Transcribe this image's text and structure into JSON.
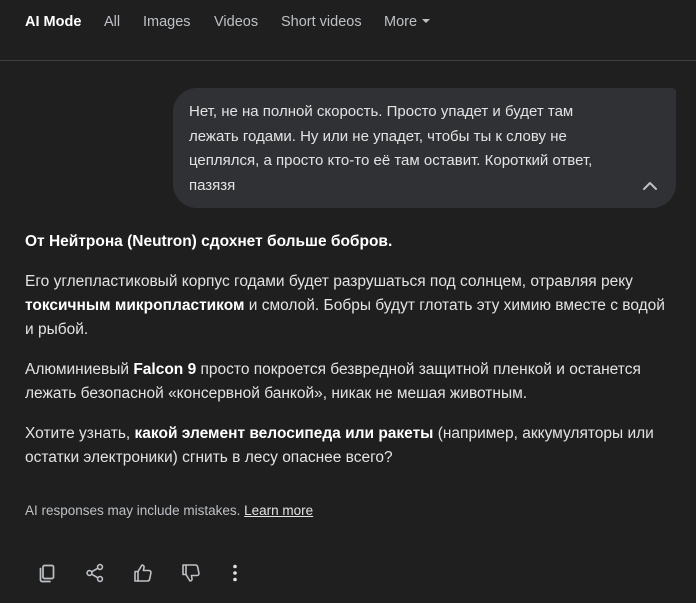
{
  "nav": {
    "tabs": [
      {
        "label": "AI Mode",
        "active": true
      },
      {
        "label": "All",
        "active": false
      },
      {
        "label": "Images",
        "active": false
      },
      {
        "label": "Videos",
        "active": false
      },
      {
        "label": "Short videos",
        "active": false
      },
      {
        "label": "More",
        "active": false
      }
    ]
  },
  "user_message": {
    "text": "Нет, не на полной скорость. Просто упадет и будет там лежать годами. Ну или не упадет, чтобы ты к слову не цеплялся, а просто кто-то её там оставит. Короткий ответ, пазязя",
    "collapse_icon": "chevron-up-icon"
  },
  "answer": {
    "heading": "От Нейтрона (Neutron) сдохнет больше бобров.",
    "p2": {
      "t1": "Его углепластиковый корпус годами будет разрушаться под солнцем, отравляя реку ",
      "b1": "токсичным микропластиком",
      "t2": " и смолой. Бобры будут глотать эту химию вместе с водой и рыбой."
    },
    "p3": {
      "t1": "Алюминиевый ",
      "b1": "Falcon 9",
      "t2": " просто покроется безвредной защитной пленкой и останется лежать безопасной «консервной банкой», никак не мешая животным."
    },
    "p4": {
      "t1": "Хотите узнать, ",
      "b1": "какой элемент велосипеда или ракеты",
      "t2": " (например, аккумуляторы или остатки электроники) сгнить в лесу опаснее всего?"
    }
  },
  "disclaimer": {
    "text": "AI responses may include mistakes. ",
    "link": "Learn more"
  },
  "actions": {
    "icons": [
      "copy-icon",
      "share-icon",
      "thumbs-up-icon",
      "thumbs-down-icon",
      "more-vert-icon"
    ]
  },
  "colors": {
    "background": "#1f1f1f",
    "bubble": "#303134",
    "text": "#e3e3e3",
    "muted": "#bdc1c6"
  }
}
